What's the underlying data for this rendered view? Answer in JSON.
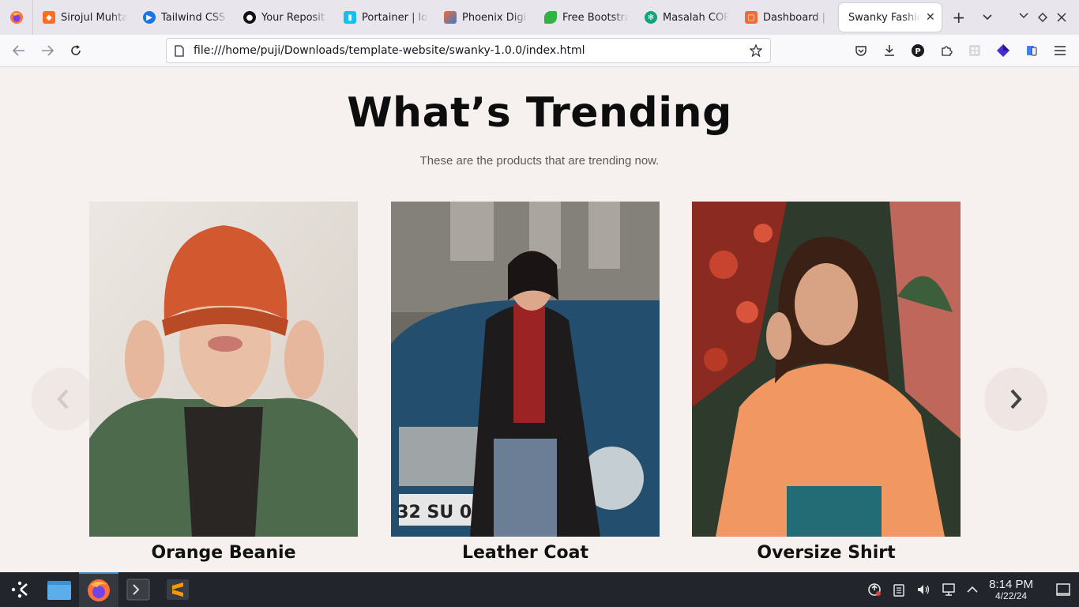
{
  "browser": {
    "tabs": [
      {
        "title": "Sirojul Muhta",
        "icon": "gitlab-icon",
        "color": "#e24329"
      },
      {
        "title": "Tailwind CSS",
        "icon": "play-icon",
        "color": "#1a73e8"
      },
      {
        "title": "Your Reposit",
        "icon": "github-icon",
        "color": "#111111"
      },
      {
        "title": "Portainer | lo",
        "icon": "portainer-icon",
        "color": "#13bef9"
      },
      {
        "title": "Phoenix Digi",
        "icon": "phoenix-icon",
        "color": "#f26a32"
      },
      {
        "title": "Free Bootstra",
        "icon": "leaf-icon",
        "color": "#2fb344"
      },
      {
        "title": "Masalah COR",
        "icon": "chatgpt-icon",
        "color": "#10a37f"
      },
      {
        "title": "Dashboard |",
        "icon": "dashboard-icon",
        "color": "#ef6c35"
      }
    ],
    "active_tab": {
      "title": "Swanky Fashio"
    },
    "url": "file:///home/puji/Downloads/template-website/swanky-1.0.0/index.html"
  },
  "page": {
    "heading": "What’s Trending",
    "subheading": "These are the products that are trending now.",
    "products": [
      {
        "name": "Orange Beanie"
      },
      {
        "name": "Leather Coat"
      },
      {
        "name": "Oversize Shirt"
      }
    ]
  },
  "taskbar": {
    "time": "8:14 PM",
    "date": "4/22/24"
  },
  "colors": {
    "page_bg": "#f6f1ee",
    "arrow_bg": "#efe6e4",
    "taskbar_bg": "#22252b"
  }
}
